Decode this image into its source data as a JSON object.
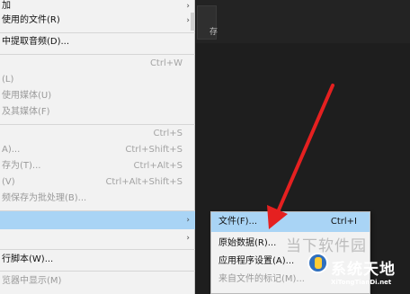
{
  "menu": {
    "items": [
      {
        "label": "加",
        "shortcut": "",
        "arrow": "›",
        "disabled": false
      },
      {
        "label": "使用的文件(R)",
        "shortcut": "",
        "arrow": "›",
        "disabled": false
      },
      {
        "label": "中提取音频(D)...",
        "shortcut": "",
        "arrow": "",
        "disabled": false
      },
      {
        "label": "",
        "shortcut": "Ctrl+W",
        "arrow": "",
        "disabled": true
      },
      {
        "label": "(L)",
        "shortcut": "",
        "arrow": "",
        "disabled": true
      },
      {
        "label": "使用媒体(U)",
        "shortcut": "",
        "arrow": "",
        "disabled": true
      },
      {
        "label": "及其媒体(F)",
        "shortcut": "",
        "arrow": "",
        "disabled": true
      },
      {
        "label": "",
        "shortcut": "Ctrl+S",
        "arrow": "",
        "disabled": true
      },
      {
        "label": "A)...",
        "shortcut": "Ctrl+Shift+S",
        "arrow": "",
        "disabled": true
      },
      {
        "label": "存为(T)...",
        "shortcut": "Ctrl+Alt+S",
        "arrow": "",
        "disabled": true
      },
      {
        "label": "(V)",
        "shortcut": "Ctrl+Alt+Shift+S",
        "arrow": "",
        "disabled": true
      },
      {
        "label": "频保存为批处理(B)...",
        "shortcut": "",
        "arrow": "",
        "disabled": true
      },
      {
        "label": "",
        "shortcut": "",
        "arrow": "›",
        "disabled": false
      },
      {
        "label": "",
        "shortcut": "",
        "arrow": "›",
        "disabled": false
      },
      {
        "label": "行脚本(W)...",
        "shortcut": "",
        "arrow": "",
        "disabled": false
      },
      {
        "label": "览器中显示(M)",
        "shortcut": "",
        "arrow": "",
        "disabled": true
      }
    ]
  },
  "right_panel": {
    "tab_text": "存"
  },
  "submenu": {
    "items": [
      {
        "label": "文件(F)...",
        "shortcut": "Ctrl+I",
        "disabled": false
      },
      {
        "label": "原始数据(R)...",
        "shortcut": "",
        "disabled": false
      },
      {
        "label": "应用程序设置(A)...",
        "shortcut": "",
        "disabled": false
      },
      {
        "label": "来自文件的标记(M)...",
        "shortcut": "",
        "disabled": true
      }
    ]
  },
  "watermark": {
    "text": "当下软件园",
    "brand_cn": "系统天地",
    "brand_en": "XiTongTianDi.net"
  },
  "colors": {
    "selection": "#a9d4f5",
    "arrow_red": "#e52020"
  }
}
